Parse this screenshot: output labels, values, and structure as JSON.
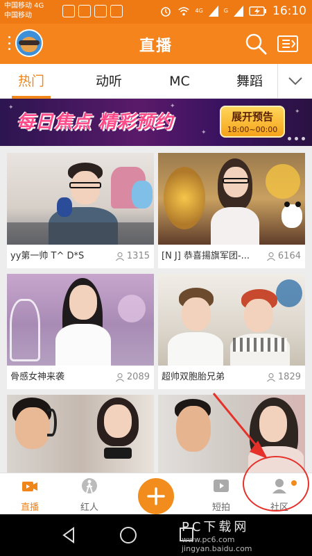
{
  "statusbar": {
    "carrier1": "中国移动 4G",
    "carrier2": "中国移动",
    "signal_label_1": "4G",
    "signal_label_2": "G",
    "time": "16:10"
  },
  "header": {
    "title": "直播"
  },
  "tabs": [
    {
      "label": "热门",
      "active": true
    },
    {
      "label": "动听",
      "active": false
    },
    {
      "label": "MC",
      "active": false
    },
    {
      "label": "舞蹈",
      "active": false
    }
  ],
  "banner": {
    "title": "每日焦点 精彩预约",
    "cta_line1": "展开预告",
    "cta_line2": "18:00~00:00"
  },
  "cards": [
    {
      "name": "yy第一帅 T^ D*S",
      "viewers": "1315"
    },
    {
      "name": "[N J] 恭喜揚旗军团-...",
      "viewers": "6164"
    },
    {
      "name": "骨感女神来袭",
      "viewers": "2089"
    },
    {
      "name": "超帅双胞胎兄弟",
      "viewers": "1829"
    }
  ],
  "bottomnav": [
    {
      "label": "直播",
      "icon": "video-camera-icon",
      "active": true
    },
    {
      "label": "红人",
      "icon": "person-icon",
      "active": false
    },
    {
      "label": "短拍",
      "icon": "play-icon",
      "active": false
    },
    {
      "label": "社区",
      "icon": "community-icon",
      "active": false
    }
  ],
  "watermark": {
    "line1": "PC下载网",
    "line2": "jingyan.baidu.com",
    "line3": "www.pc6.com"
  },
  "colors": {
    "brand_orange": "#f5841d",
    "accent_orange": "#f08519",
    "annotation_red": "#e6312b"
  }
}
